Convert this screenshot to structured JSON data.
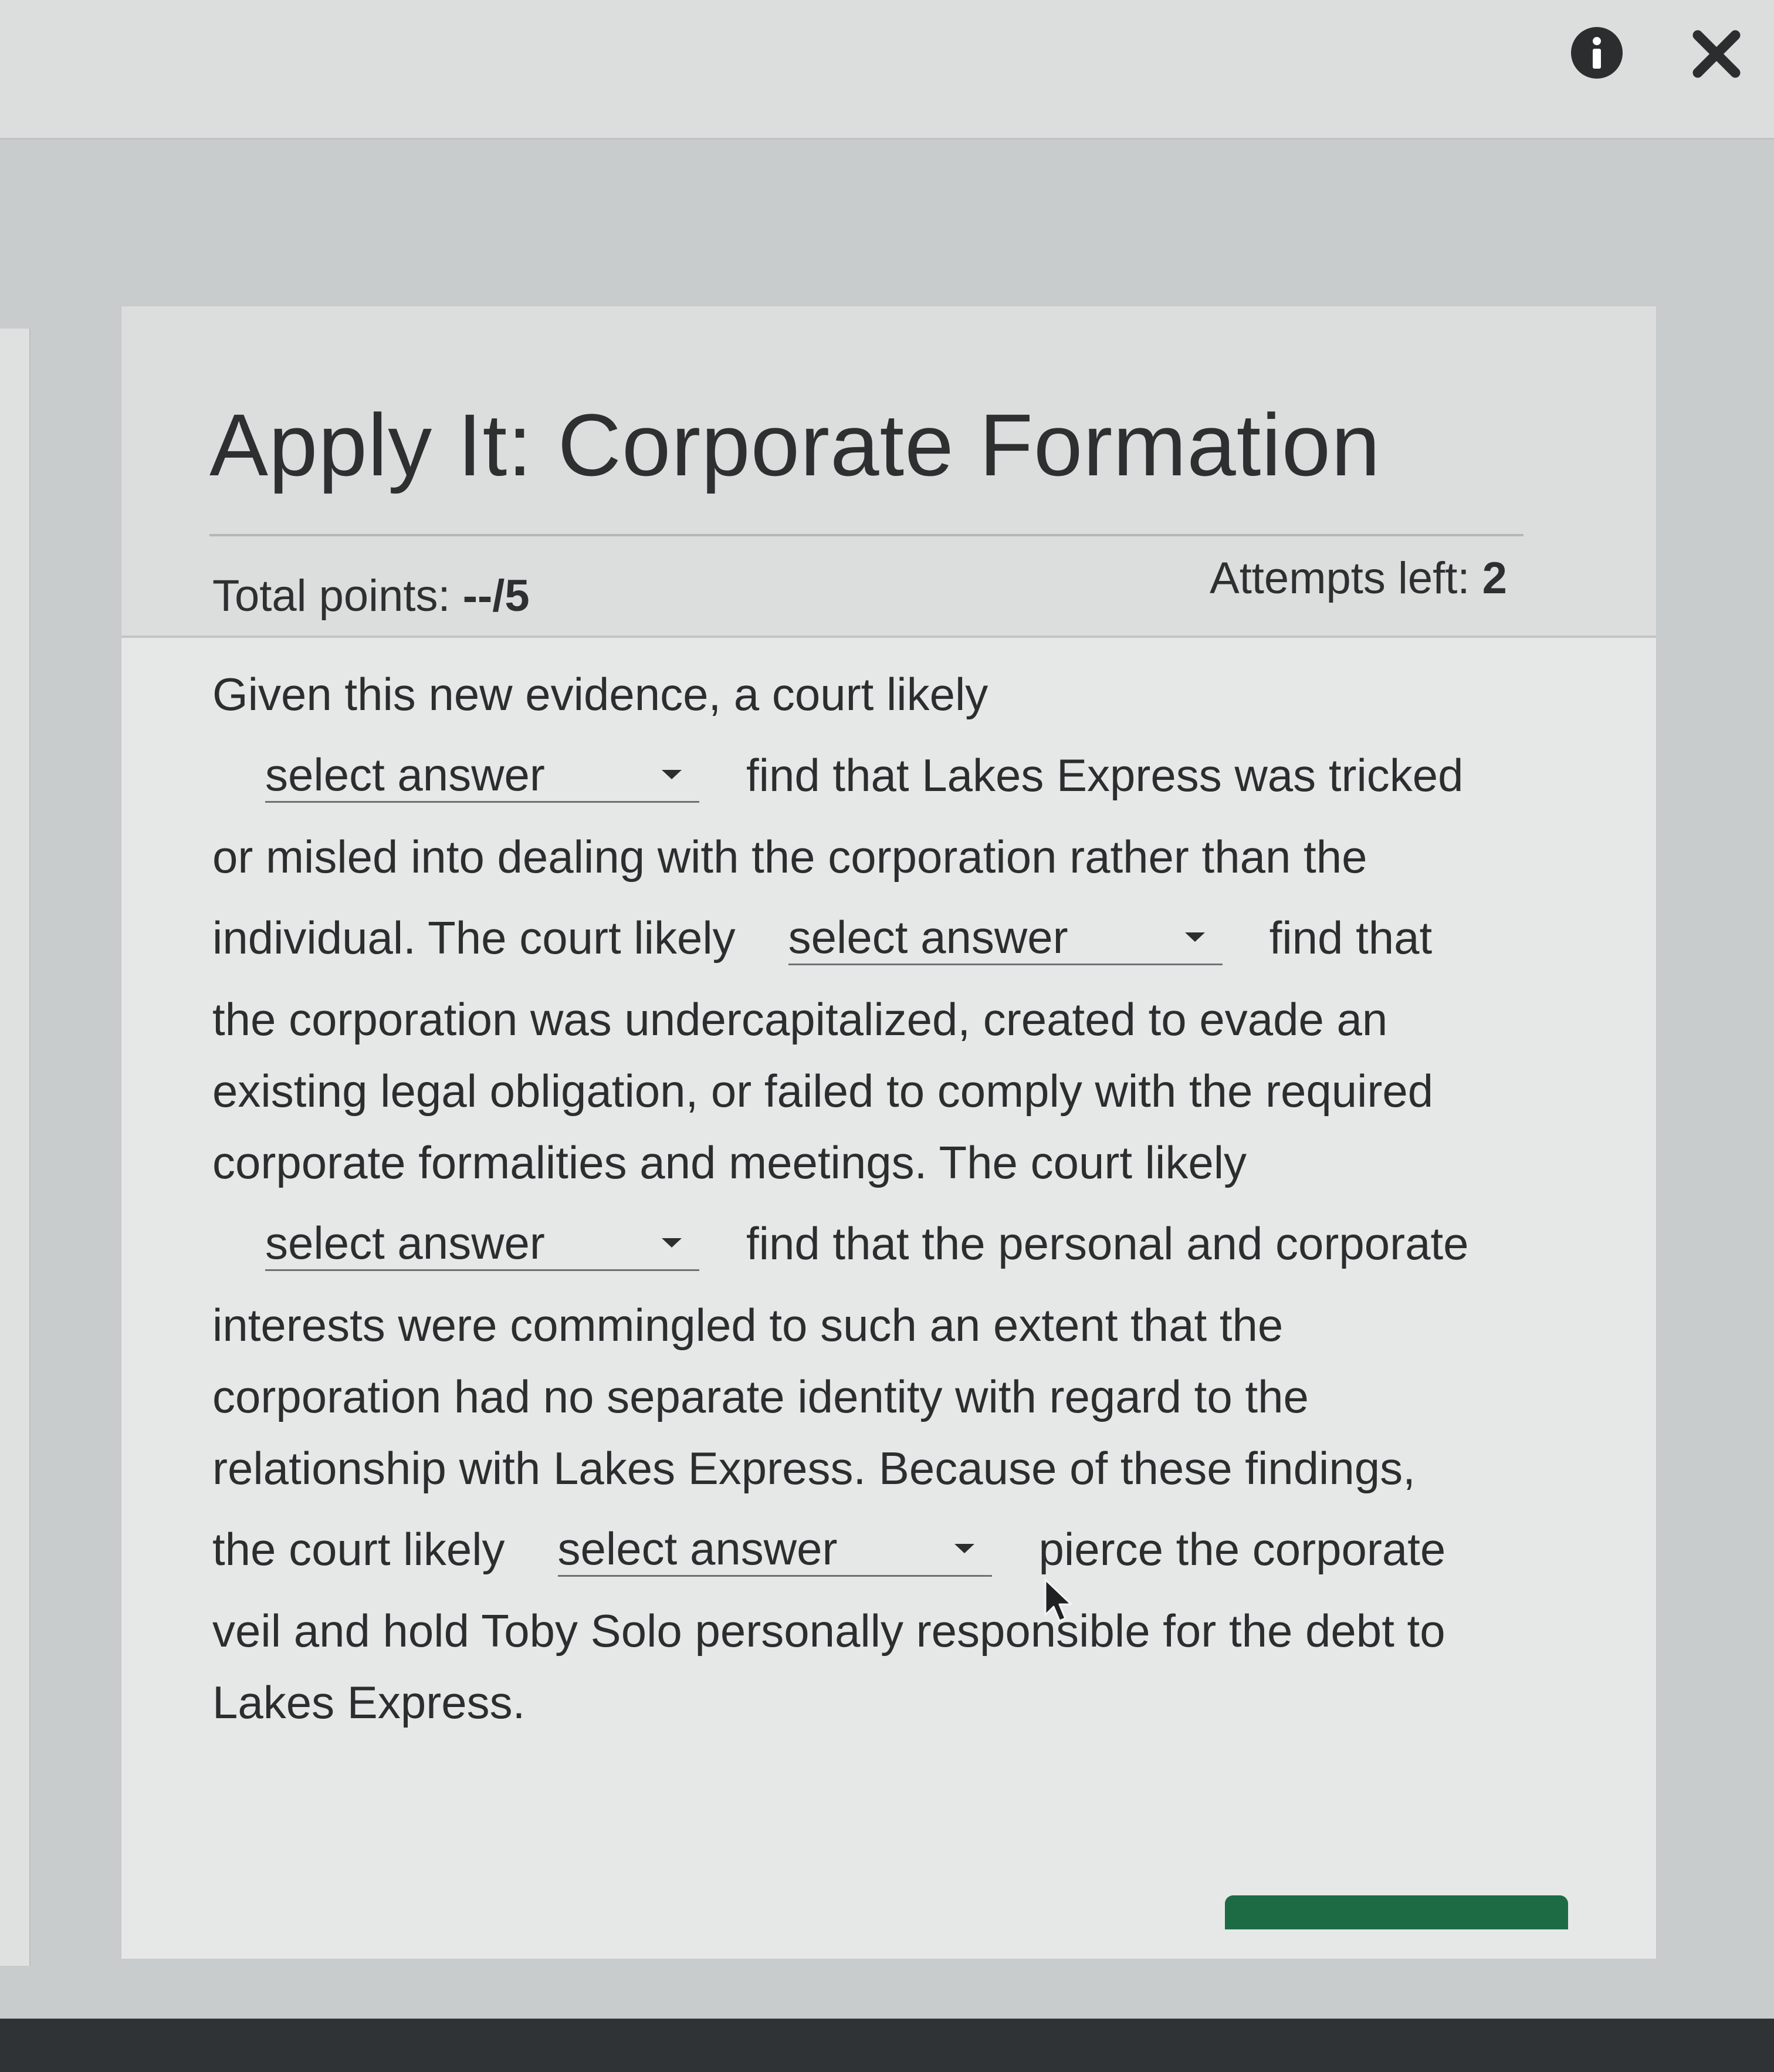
{
  "window": {
    "info_icon": "info-icon",
    "close_icon": "close-icon",
    "close_glyph": "✕"
  },
  "dialog": {
    "title": "Apply It: Corporate Formation",
    "total_points_label": "Total points: ",
    "total_points_value": "--/5",
    "attempts_label": "Attempts left: ",
    "attempts_value": "2"
  },
  "question": {
    "line1": "Given this new evidence, a court likely",
    "dropdown1": "select answer",
    "line2_after": "find that Lakes Express was tricked",
    "line3": "or misled into dealing with the corporation rather than the",
    "line4_before": "individual. The court likely",
    "dropdown2": "select answer",
    "line4_after": "find that",
    "line5": "the corporation was undercapitalized, created to evade an",
    "line6": "existing legal obligation, or failed to comply with the required",
    "line7": "corporate formalities and meetings. The court likely",
    "dropdown3": "select answer",
    "line8_after": "find that the personal and corporate",
    "line9": "interests were commingled to such an extent that the",
    "line10": "corporation had no separate identity with regard to the",
    "line11": "relationship with Lakes Express. Because of these findings,",
    "line12_before": "the court likely",
    "dropdown4": "select answer",
    "line12_after": "pierce the corporate",
    "line13": "veil and hold Toby Solo personally responsible for the debt to",
    "line14": "Lakes Express."
  },
  "colors": {
    "accent_green": "#1d6b44",
    "text": "#2b2d2f"
  }
}
